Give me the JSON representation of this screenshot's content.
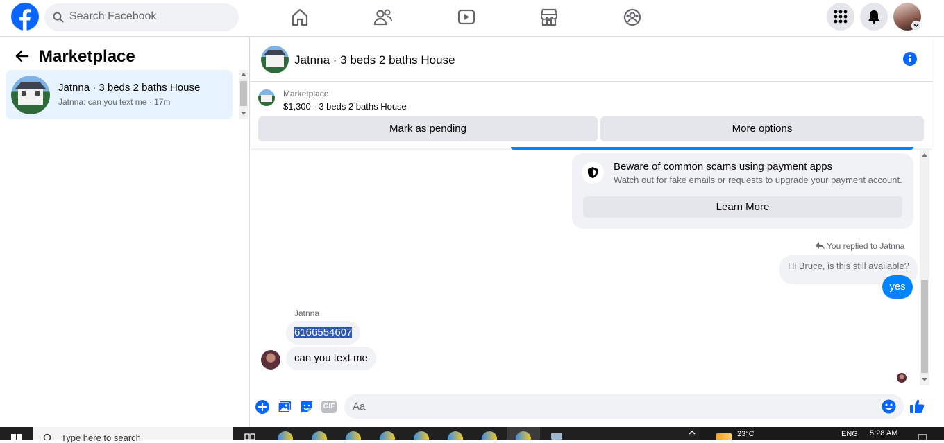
{
  "topbar": {
    "search_placeholder": "Search Facebook"
  },
  "sidebar": {
    "title": "Marketplace",
    "conversation": {
      "title": "Jatnna · 3 beds 2 baths House",
      "preview": "Jatnna: can you text me · 17m"
    }
  },
  "chat": {
    "header_title": "Jatnna · 3 beds 2 baths House",
    "listing_label": "Marketplace",
    "listing_price": "$1,300 - 3 beds 2 baths House",
    "mark_pending": "Mark as pending",
    "more_options": "More options",
    "scam_title": "Beware of common scams using payment apps",
    "scam_text": "Watch out for fake emails or requests to upgrade your payment account.",
    "learn_more": "Learn More",
    "replied_to": "You replied to Jatnna",
    "quoted_text": "Hi Bruce, is this still available?",
    "my_reply": "yes",
    "sender_name": "Jatnna",
    "msg_phone": "6166554607",
    "msg_text": "can you text me",
    "composer_placeholder": "Aa",
    "gif_label": "GIF"
  },
  "taskbar": {
    "search_text": "Type here to search",
    "temperature": "23°C",
    "language": "ENG",
    "time": "5:28 AM"
  },
  "colors": {
    "brand": "#0866ff",
    "messenger_blue": "#0084ff",
    "selected_row": "#e7f3ff"
  }
}
